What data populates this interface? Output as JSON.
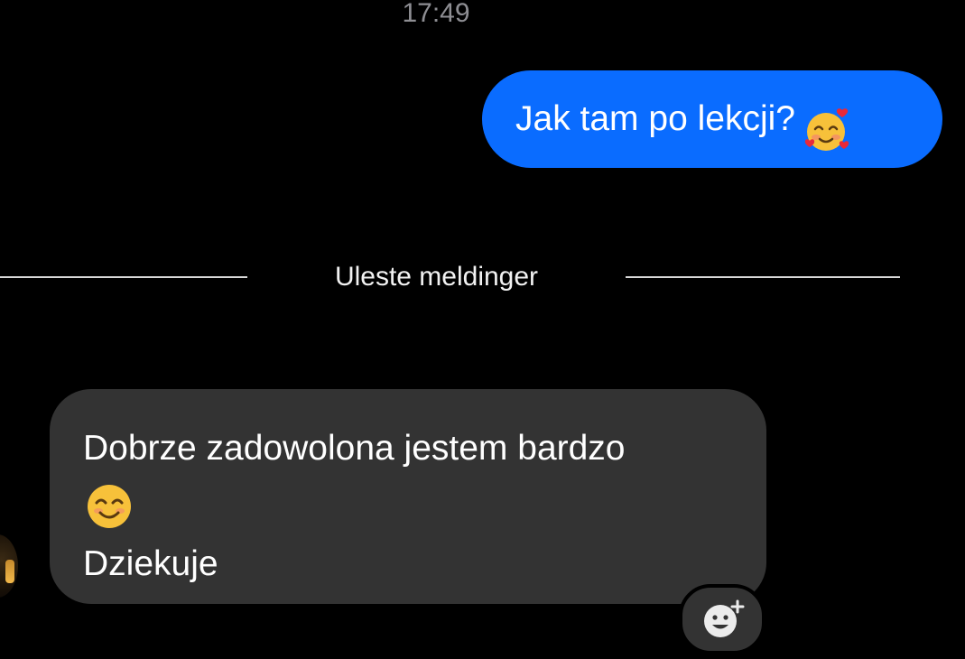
{
  "timestamp": "17:49",
  "messages": {
    "outgoing": {
      "text": "Jak tam po lekcji?",
      "emoji": "smiling-face-with-hearts"
    },
    "divider": {
      "label": "Uleste meldinger"
    },
    "incoming": {
      "line1": "Dobrze zadowolona jestem bardzo",
      "emoji": "smiling-face-with-smiling-eyes",
      "line3": "Dziekuje"
    }
  },
  "reaction_button": {
    "icon": "add-reaction-icon"
  },
  "colors": {
    "background": "#000000",
    "outgoing_bubble": "#0a6cff",
    "incoming_bubble": "#333333",
    "timestamp": "#8e8e93"
  }
}
